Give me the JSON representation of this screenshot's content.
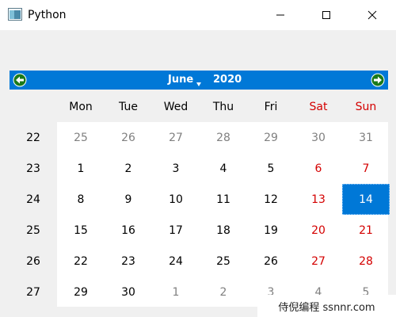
{
  "window": {
    "title": "Python"
  },
  "calendar": {
    "month": "June",
    "year": "2020",
    "weekday_headers": [
      "Mon",
      "Tue",
      "Wed",
      "Thu",
      "Fri",
      "Sat",
      "Sun"
    ],
    "selected_day": "14",
    "weeks": [
      {
        "week": "22",
        "days": [
          {
            "d": "25",
            "o": true
          },
          {
            "d": "26",
            "o": true
          },
          {
            "d": "27",
            "o": true
          },
          {
            "d": "28",
            "o": true
          },
          {
            "d": "29",
            "o": true
          },
          {
            "d": "30",
            "o": true
          },
          {
            "d": "31",
            "o": true
          }
        ]
      },
      {
        "week": "23",
        "days": [
          {
            "d": "1"
          },
          {
            "d": "2"
          },
          {
            "d": "3"
          },
          {
            "d": "4"
          },
          {
            "d": "5"
          },
          {
            "d": "6"
          },
          {
            "d": "7"
          }
        ]
      },
      {
        "week": "24",
        "days": [
          {
            "d": "8"
          },
          {
            "d": "9"
          },
          {
            "d": "10"
          },
          {
            "d": "11"
          },
          {
            "d": "12"
          },
          {
            "d": "13"
          },
          {
            "d": "14",
            "s": true
          }
        ]
      },
      {
        "week": "25",
        "days": [
          {
            "d": "15"
          },
          {
            "d": "16"
          },
          {
            "d": "17"
          },
          {
            "d": "18"
          },
          {
            "d": "19"
          },
          {
            "d": "20"
          },
          {
            "d": "21"
          }
        ]
      },
      {
        "week": "26",
        "days": [
          {
            "d": "22"
          },
          {
            "d": "23"
          },
          {
            "d": "24"
          },
          {
            "d": "25"
          },
          {
            "d": "26"
          },
          {
            "d": "27"
          },
          {
            "d": "28"
          }
        ]
      },
      {
        "week": "27",
        "days": [
          {
            "d": "29"
          },
          {
            "d": "30"
          },
          {
            "d": "1",
            "o": true
          },
          {
            "d": "2",
            "o": true
          },
          {
            "d": "3",
            "o": true
          },
          {
            "d": "4",
            "o": true
          },
          {
            "d": "5",
            "o": true
          }
        ]
      }
    ]
  },
  "colors": {
    "accent": "#0078d7",
    "weekend": "#d40000",
    "other_month": "#808080",
    "nav_arrow": "#1a7a1a"
  },
  "watermark": {
    "text": "侍倪编程 ssnnr.com"
  }
}
